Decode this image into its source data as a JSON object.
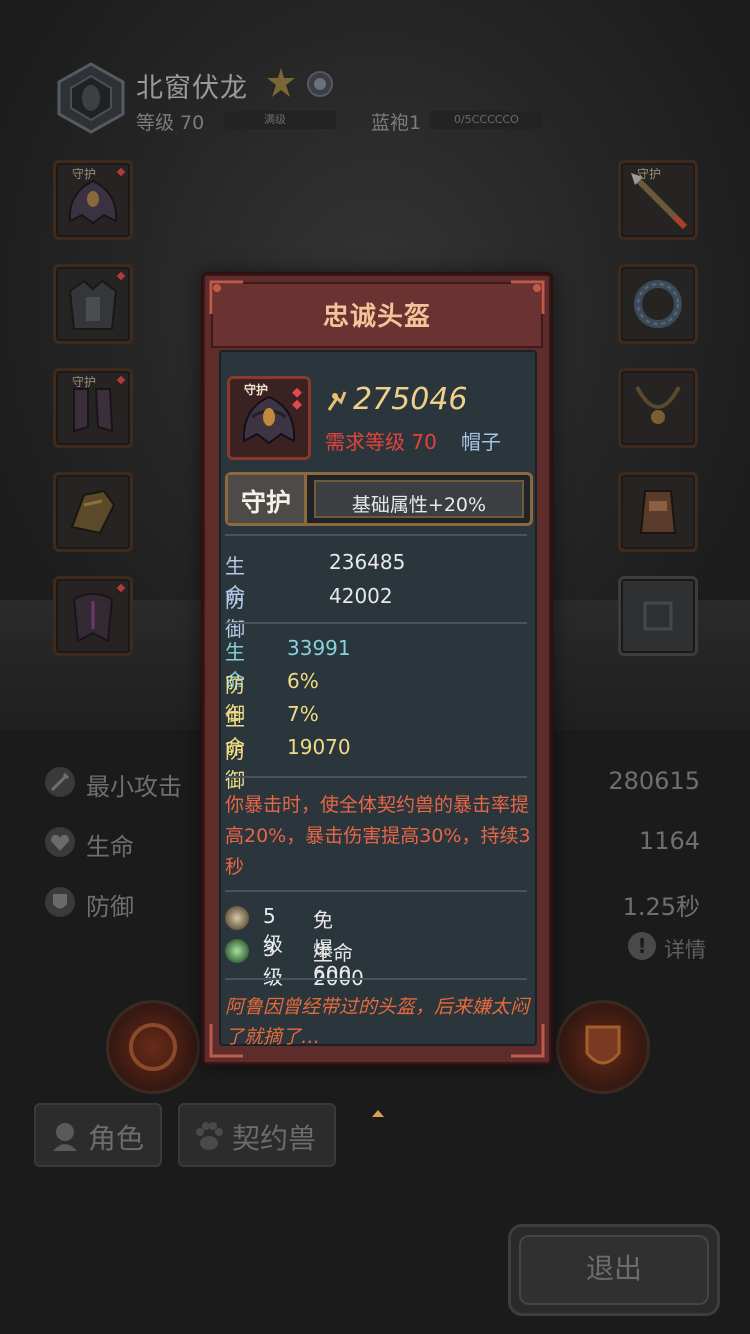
{
  "hero": {
    "name": "北窗伏龙",
    "level_label": "等级 70",
    "level_bar_label": "满级",
    "rank_label": "蓝袍1",
    "exp_bar_label": "0/5CCCCCO"
  },
  "slots": {
    "left": [
      {
        "tag": "守护",
        "icon": "helmet-icon"
      },
      {
        "tag": "",
        "icon": "armor-icon"
      },
      {
        "tag": "守护",
        "icon": "boots-icon"
      },
      {
        "tag": "",
        "icon": "gauntlet-icon"
      },
      {
        "tag": "",
        "icon": "cloak-icon"
      }
    ],
    "right": [
      {
        "tag": "守护",
        "icon": "spear-icon"
      },
      {
        "tag": "",
        "icon": "ring-icon"
      },
      {
        "tag": "",
        "icon": "necklace-icon"
      },
      {
        "tag": "",
        "icon": "bracer-icon"
      },
      {
        "tag": "",
        "icon": "empty-slot-icon"
      }
    ]
  },
  "stats": [
    {
      "label": "最小攻击",
      "value": "280615",
      "icon": "sword-icon"
    },
    {
      "label": "生命",
      "value": "1164",
      "icon": "heart-icon"
    },
    {
      "label": "防御",
      "value": "1.25秒",
      "icon": "shield-icon"
    }
  ],
  "detail_label": "详情",
  "tabs": {
    "character": "角色",
    "pet": "契约兽"
  },
  "exit_label": "退出",
  "modal": {
    "title": "忠诚头盔",
    "item_tag": "守护",
    "power": "275046",
    "requirement": "需求等级 70",
    "item_type": "帽子",
    "guard_tag": "守护",
    "guard_text": "基础属性+20%",
    "base_attrs": [
      {
        "key": "生命",
        "value": "236485"
      },
      {
        "key": "防御",
        "value": "42002"
      }
    ],
    "sub_attrs": [
      {
        "key": "生命",
        "value": "33991",
        "color": "#86d2dd"
      },
      {
        "key": "防御",
        "value": "6%",
        "color": "#f0dc84"
      },
      {
        "key": "生命",
        "value": "7%",
        "color": "#f0dc84"
      },
      {
        "key": "防御",
        "value": "19070",
        "color": "#f0dc84"
      }
    ],
    "description": "你暴击时，使全体契约兽的暴击率提高20%，暴击伤害提高30%，持续3秒",
    "gems": [
      {
        "level": "5级",
        "stat": "免爆 600",
        "color": "#c9b89a"
      },
      {
        "level": "3级",
        "stat": "生命 2000",
        "color": "#8ec98a"
      }
    ],
    "lore": "阿鲁因曾经带过的头盔，后来嫌太闷了就摘了…"
  },
  "colors": {
    "accent_red": "#e3433a",
    "gold": "#f0d08a",
    "panel": "#2b353c",
    "frame": "#5e2d2b"
  }
}
